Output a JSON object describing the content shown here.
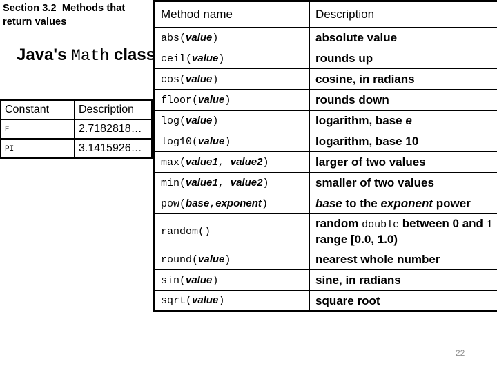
{
  "slide": {
    "section_heading": "Section 3.2  Methods that return values",
    "title_prefix": "Java's ",
    "title_mono": "Math",
    "title_suffix": " class",
    "page_number": "22"
  },
  "constants_table": {
    "headers": [
      "Constant",
      "Description"
    ],
    "rows": [
      {
        "constant": "E",
        "description": "2.7182818…"
      },
      {
        "constant": "PI",
        "description": "3.1415926…"
      }
    ]
  },
  "methods_table": {
    "headers": [
      "Method name",
      "Description"
    ],
    "rows": [
      {
        "method": "abs",
        "open": "(",
        "params": [
          "value"
        ],
        "sep": ", ",
        "close": ")",
        "description": "absolute value"
      },
      {
        "method": "ceil",
        "open": "(",
        "params": [
          "value"
        ],
        "sep": ", ",
        "close": ")",
        "description": "rounds up"
      },
      {
        "method": "cos",
        "open": "(",
        "params": [
          "value"
        ],
        "sep": ", ",
        "close": ")",
        "description": "cosine, in radians"
      },
      {
        "method": "floor",
        "open": "(",
        "params": [
          "value"
        ],
        "sep": ", ",
        "close": ")",
        "description": "rounds down"
      },
      {
        "method": "log",
        "open": "(",
        "params": [
          "value"
        ],
        "sep": ", ",
        "close": ")",
        "description": "logarithm, base e",
        "desc_parts": [
          {
            "text": "logarithm, base ",
            "style": "bold"
          },
          {
            "text": "e",
            "style": "italic"
          }
        ]
      },
      {
        "method": "log10",
        "open": "(",
        "params": [
          "value"
        ],
        "sep": ", ",
        "close": ")",
        "description": "logarithm, base 10"
      },
      {
        "method": "max",
        "open": "(",
        "params": [
          "value1",
          "value2"
        ],
        "sep": ", ",
        "close": ")",
        "description": "larger of two values"
      },
      {
        "method": "min",
        "open": "(",
        "params": [
          "value1",
          "value2"
        ],
        "sep": ", ",
        "close": ")",
        "description": "smaller of two values"
      },
      {
        "method": "pow",
        "open": "(",
        "params": [
          "base",
          "exponent"
        ],
        "sep": ",",
        "close": ")",
        "description": "base to the exponent power",
        "desc_parts": [
          {
            "text": "base",
            "style": "italic"
          },
          {
            "text": " to the ",
            "style": "bold"
          },
          {
            "text": "exponent",
            "style": "italic"
          },
          {
            "text": " power",
            "style": "bold"
          }
        ]
      },
      {
        "method": "random",
        "open": "(",
        "params": [],
        "sep": ", ",
        "close": ")",
        "description": "random double between 0 and 1  range [0.0, 1.0)",
        "desc_parts": [
          {
            "text": "random ",
            "style": "bold"
          },
          {
            "text": "double",
            "style": "mono"
          },
          {
            "text": " between 0 and ",
            "style": "bold"
          },
          {
            "text": "1",
            "style": "mono"
          },
          {
            "text": "  range [0.0, 1.0)",
            "style": "bold"
          }
        ]
      },
      {
        "method": "round",
        "open": "(",
        "params": [
          "value"
        ],
        "sep": ", ",
        "close": ")",
        "description": "nearest whole number"
      },
      {
        "method": "sin",
        "open": "(",
        "params": [
          "value"
        ],
        "sep": ", ",
        "close": ")",
        "description": "sine, in radians"
      },
      {
        "method": "sqrt",
        "open": "(",
        "params": [
          "value"
        ],
        "sep": ", ",
        "close": ")",
        "description": "square root"
      }
    ]
  }
}
